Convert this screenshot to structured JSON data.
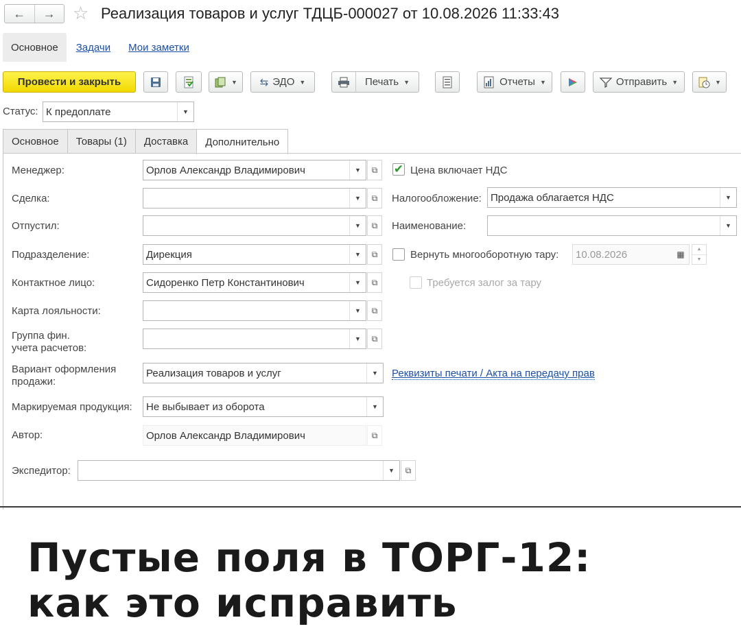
{
  "header": {
    "back_icon": "←",
    "forward_icon": "→",
    "star_icon": "☆",
    "title": "Реализация товаров и услуг ТДЦБ-000027 от 10.08.2026 11:33:43"
  },
  "topnav": {
    "items": [
      "Основное",
      "Задачи",
      "Мои заметки"
    ]
  },
  "toolbar": {
    "post_close": "Провести и закрыть",
    "edo": "ЭДО",
    "print": "Печать",
    "reports": "Отчеты",
    "send": "Отправить"
  },
  "status": {
    "label": "Статус:",
    "value": "К предоплате"
  },
  "tabs": [
    "Основное",
    "Товары (1)",
    "Доставка",
    "Дополнительно"
  ],
  "form": {
    "manager_label": "Менеджер:",
    "manager_value": "Орлов Александр Владимирович",
    "deal_label": "Сделка:",
    "deal_value": "",
    "released_label": "Отпустил:",
    "released_value": "",
    "division_label": "Подразделение:",
    "division_value": "Дирекция",
    "contact_label": "Контактное лицо:",
    "contact_value": "Сидоренко Петр Константинович",
    "loyalty_label": "Карта лояльности:",
    "loyalty_value": "",
    "fin_group_label_1": "Группа фин.",
    "fin_group_label_2": "учета расчетов:",
    "fin_group_value": "",
    "variant_label_1": "Вариант оформления",
    "variant_label_2": "продажи:",
    "variant_value": "Реализация товаров и услуг",
    "marked_label": "Маркируемая продукция:",
    "marked_value": "Не выбывает из оборота",
    "author_label": "Автор:",
    "author_value": "Орлов Александр Владимирович",
    "forwarder_label": "Экспедитор:",
    "forwarder_value": "",
    "price_vat_label": "Цена включает НДС",
    "price_vat_checked": true,
    "taxation_label": "Налогообложение:",
    "taxation_value": "Продажа облагается НДС",
    "naming_label": "Наименование:",
    "naming_value": "",
    "return_tare_label": "Вернуть многооборотную тару:",
    "return_tare_date": "10.08.2026",
    "deposit_label": "Требуется залог за тару",
    "print_link": "Реквизиты печати / Акта на передачу прав"
  },
  "caption": {
    "line1": "Пустые поля в ТОРГ-12:",
    "line2": "как это исправить"
  },
  "colors": {
    "primary_button": "#f5dc12",
    "link": "#1c4fa5",
    "check": "#2a9a2a"
  }
}
